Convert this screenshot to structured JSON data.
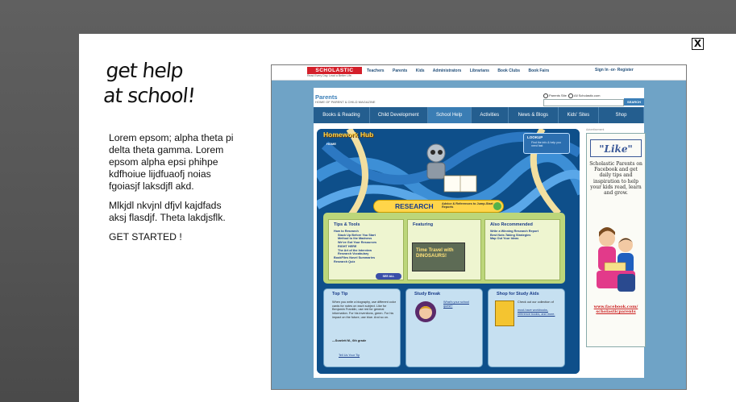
{
  "close_button": {
    "label": "X"
  },
  "hero": {
    "headline_line1": "get help",
    "headline_line2": "at school!",
    "paragraph1": "Lorem epsom; alpha theta pi delta theta gamma. Lorem epsom alpha epsi phihpe kdfhoiue lijdfuaofj noias fgoiasjf laksdjfl akd.",
    "paragraph2": "Mlkjdl nkvjnl dfjvl kajdfads aksj flasdjf. Theta lakdjsflk.",
    "cta": "GET STARTED !"
  },
  "site": {
    "logo": "SCHOLASTIC",
    "tagline": "Read Every Day. Lead a Better Life.",
    "top_links": [
      "Teachers",
      "Parents",
      "Kids",
      "Administrators",
      "Librarians",
      "Book Clubs",
      "Book Fairs"
    ],
    "sign_in": "Sign In -or- Register",
    "brand": "Parents",
    "brand_sub": "HOME OF PARENT & CHILD MAGAZINE",
    "search_options": [
      "Parents Site",
      "All Scholastic.com"
    ],
    "search_button": "SEARCH",
    "nav": [
      "Books & Reading",
      "Child Development",
      "School Help",
      "Activities",
      "News & Blogs",
      "Kids' Sites",
      "Shop"
    ],
    "nav_active_index": 2,
    "ad_label": "Advertisement"
  },
  "hub": {
    "title": "Homework Hub",
    "home_link": "HOME",
    "lookup_title": "LOOKUP",
    "lookup_desc": "Find the info & help you need fast",
    "research_title": "RESEARCH",
    "research_sub": "Advice & References to Jump-Start Reports",
    "tips_title": "Tips & Tools",
    "tips_items": [
      "How to Research",
      "Stack Up Before You Start",
      "Method to the Madness",
      "We've Got Your Resources",
      "RIGHT HERE",
      "The Art of the Interview",
      "Research Vocabulary",
      "BookFiles Novel Summaries",
      "Research Quiz"
    ],
    "see_all": "SEE ALL",
    "featuring_title": "Featuring",
    "featuring_item": "Time Travel with DINOSAURS!",
    "recommended_title": "Also Recommended",
    "recommended_items": [
      "Write a Winning Research Report",
      "Best Note-Taking Strategies",
      "Map Out Your Ideas"
    ],
    "top_tip_title": "Top Tip",
    "top_tip_text": "When you write a biography, use different color cards for notes on each subject. Like for Benjamin Franklin, use red for general information. For his inventions, green. For his impact on the future, use blue. And so on.",
    "top_tip_author": "—Scarlett M., 6th grade",
    "top_tip_link": "Tell Us Your Tip",
    "study_break_title": "Study Break",
    "study_break_link": "What's your school quest?",
    "shop_title": "Shop for Study Aids",
    "shop_text": "Check out our collection of",
    "shop_links": "must-have workbooks, reference books, and more."
  },
  "facebook_ad": {
    "like": "\"Like\"",
    "text": "Scholastic Parents on Facebook and get daily tips and inspiration to help your kids read, learn and grow.",
    "url": "www.facebook.com/ scholasticparents"
  },
  "colors": {
    "nav_blue": "#245e8f",
    "scholastic_red": "#d4202b",
    "hub_blue": "#0e4f8a",
    "green_panel": "#bcd67a"
  }
}
